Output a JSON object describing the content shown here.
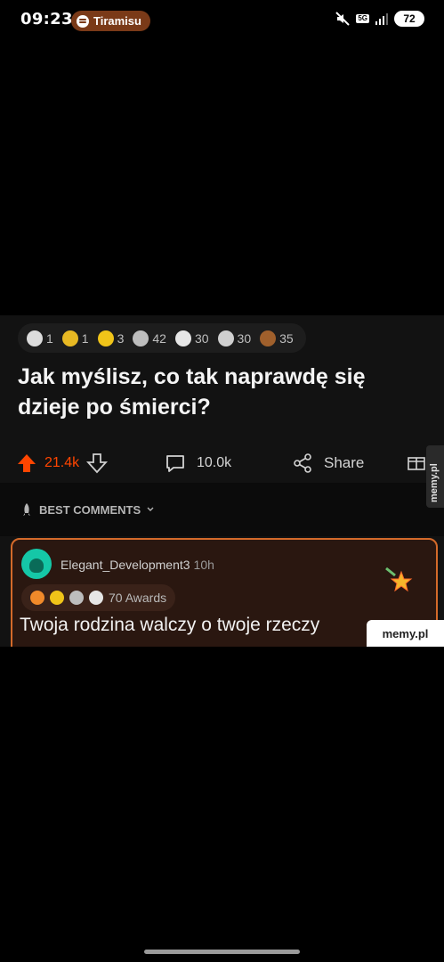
{
  "status_bar": {
    "time": "09:23",
    "music": "Tiramisu",
    "network": "5G",
    "battery": "72"
  },
  "post": {
    "awards": [
      {
        "icon": "helpful-award-icon",
        "count": "1"
      },
      {
        "icon": "wholesome-award-icon",
        "count": "1"
      },
      {
        "icon": "gold-award-icon",
        "count": "3"
      },
      {
        "icon": "plus-award-icon",
        "count": "42"
      },
      {
        "icon": "silver-award-icon",
        "count": "30"
      },
      {
        "icon": "s-award-icon",
        "count": "30"
      },
      {
        "icon": "bear-award-icon",
        "count": "35"
      }
    ],
    "title": "Jak myślisz, co tak naprawdę się dzieje po śmierci?",
    "upvotes": "21.4k",
    "comments": "10.0k",
    "share_label": "Share",
    "sort_label": "BEST COMMENTS"
  },
  "comment": {
    "username": "Elegant_Development3",
    "time_ago": "10h",
    "awards_label": "70 Awards",
    "text": "Twoja rodzina walczy o twoje rzeczy"
  },
  "watermarks": {
    "side": "memy.pl",
    "bottom": "memy.pl"
  },
  "colors": {
    "accent": "#ff4500",
    "comment_border": "#d46a2a"
  }
}
